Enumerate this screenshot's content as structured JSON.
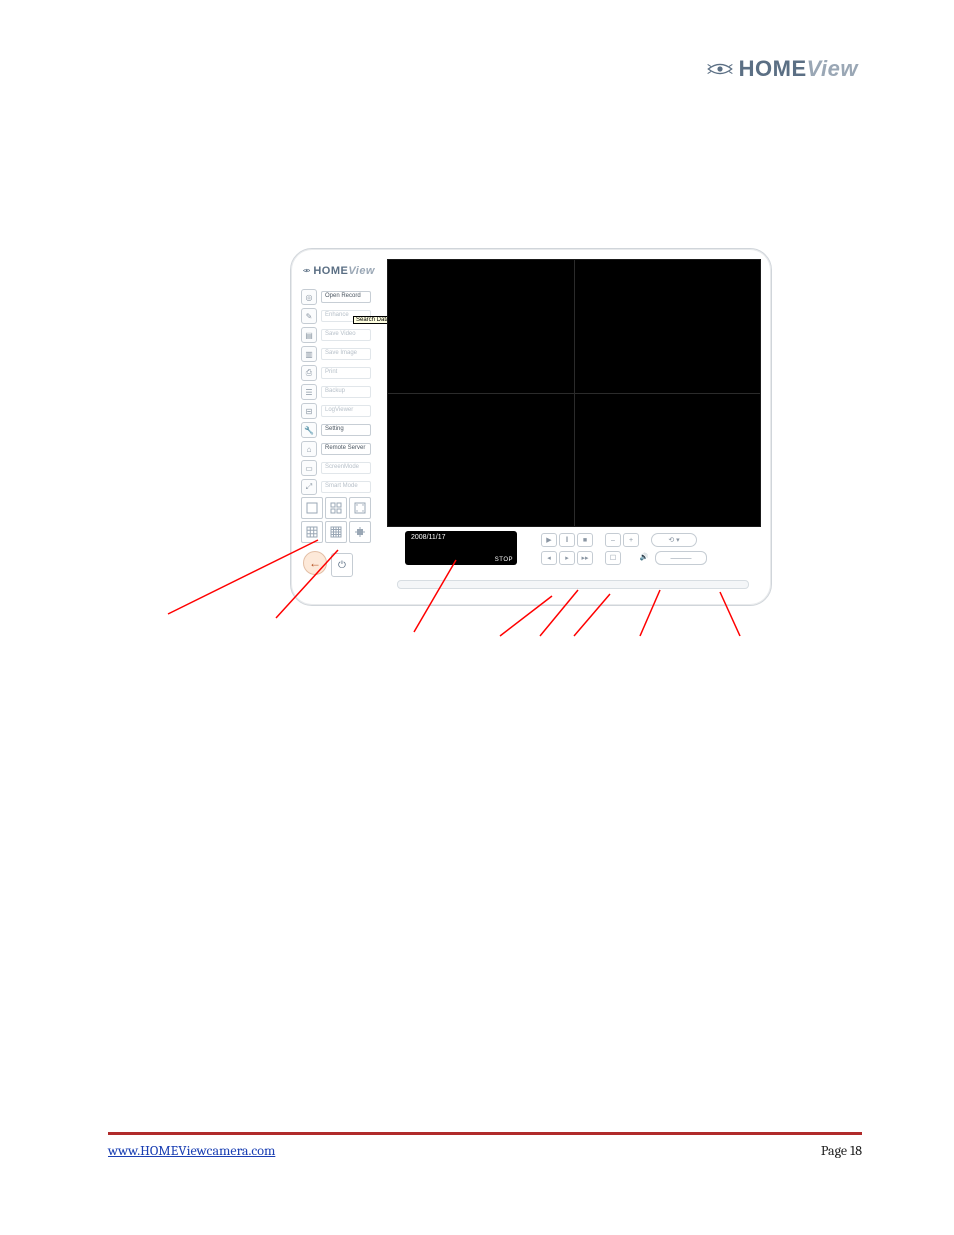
{
  "header": {
    "brand_home": "HOME",
    "brand_view": "View"
  },
  "app": {
    "brand_home": "HOME",
    "brand_view": "View",
    "sidebar": [
      {
        "icon": "◎",
        "label": "Open Record",
        "dim": false
      },
      {
        "icon": "✎",
        "label": "Enhance",
        "dim": true
      },
      {
        "icon": "▤",
        "label": "Save Video",
        "dim": true
      },
      {
        "icon": "▥",
        "label": "Save Image",
        "dim": true
      },
      {
        "icon": "⎙",
        "label": "Print",
        "dim": true
      },
      {
        "icon": "☰",
        "label": "Backup",
        "dim": true
      },
      {
        "icon": "⊟",
        "label": "LogViewer",
        "dim": true
      },
      {
        "icon": "🔧",
        "label": "Setting",
        "dim": false
      },
      {
        "icon": "⌂",
        "label": "Remote Server",
        "dim": false
      },
      {
        "icon": "▭",
        "label": "ScreenMode",
        "dim": true
      },
      {
        "icon": "⤢",
        "label": "Smart Mode",
        "dim": true
      }
    ],
    "tooltip": "Search Database by Date/Time",
    "status": {
      "date": "2008/11/17",
      "state": "STOP"
    },
    "controls": {
      "row1": [
        "▶",
        "‖",
        "■",
        "–",
        "+",
        "⟲ ▾"
      ],
      "row2": [
        "◂",
        "▸",
        "▸▸",
        "☐",
        "🔊",
        "———"
      ]
    }
  },
  "footer": {
    "link": "www.HOMEViewcamera.com",
    "page": "Page 18"
  }
}
